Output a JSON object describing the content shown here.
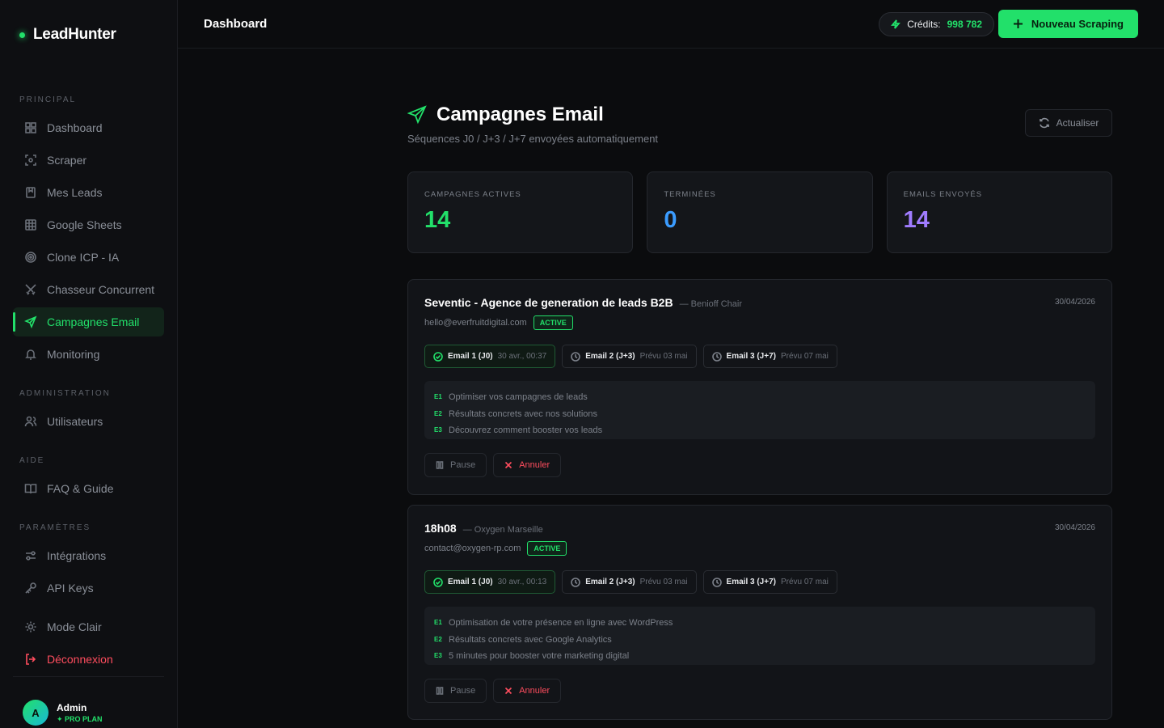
{
  "app": {
    "name": "LeadHunter"
  },
  "sidebar": {
    "sections": [
      "PRINCIPAL",
      "ADMINISTRATION",
      "AIDE",
      "PARAMÈTRES"
    ],
    "items": [
      {
        "label": "Dashboard",
        "icon": "grid-icon"
      },
      {
        "label": "Scraper",
        "icon": "scan-icon"
      },
      {
        "label": "Mes Leads",
        "icon": "bookmark-icon"
      },
      {
        "label": "Google Sheets",
        "icon": "table-icon"
      },
      {
        "label": "Clone ICP - IA",
        "icon": "target-icon"
      },
      {
        "label": "Chasseur Concurrent",
        "icon": "swords-icon"
      },
      {
        "label": "Campagnes Email",
        "icon": "send-icon",
        "active": true
      },
      {
        "label": "Monitoring",
        "icon": "bell-icon"
      },
      {
        "label": "Utilisateurs",
        "icon": "users-icon"
      },
      {
        "label": "FAQ & Guide",
        "icon": "book-icon"
      },
      {
        "label": "Intégrations",
        "icon": "sliders-icon"
      },
      {
        "label": "API Keys",
        "icon": "key-icon"
      },
      {
        "label": "Mode Clair",
        "icon": "sun-icon"
      },
      {
        "label": "Déconnexion",
        "icon": "logout-icon"
      }
    ],
    "user": {
      "initial": "A",
      "name": "Admin",
      "plan": "✦ PRO PLAN"
    }
  },
  "topbar": {
    "title": "Dashboard",
    "credits_label": "Crédits:",
    "credits_value": "998 782",
    "new_button": "Nouveau Scraping"
  },
  "page": {
    "title": "Campagnes Email",
    "subtitle": "Séquences J0 / J+3 / J+7 envoyées automatiquement",
    "refresh": "Actualiser"
  },
  "stats": [
    {
      "label": "CAMPAGNES ACTIVES",
      "value": "14",
      "color": "#22e06a"
    },
    {
      "label": "TERMINÉES",
      "value": "0",
      "color": "#3b9cff"
    },
    {
      "label": "EMAILS ENVOYÉS",
      "value": "14",
      "color": "#a07cff"
    }
  ],
  "campaigns": [
    {
      "name": "Seventic - Agence de generation de leads B2B",
      "contact": "— Benioff Chair",
      "date": "30/04/2026",
      "email": "hello@everfruitdigital.com",
      "status": "ACTIVE",
      "steps": [
        {
          "name": "Email 1 (J0)",
          "meta": "30 avr., 00:37",
          "done": true
        },
        {
          "name": "Email 2 (J+3)",
          "meta": "Prévu 03 mai",
          "done": false
        },
        {
          "name": "Email 3 (J+7)",
          "meta": "Prévu 07 mai",
          "done": false
        }
      ],
      "subjects": [
        {
          "tag": "E1",
          "text": "Optimiser vos campagnes de leads"
        },
        {
          "tag": "E2",
          "text": "Résultats concrets avec nos solutions"
        },
        {
          "tag": "E3",
          "text": "Découvrez comment booster vos leads"
        }
      ],
      "pause": "Pause",
      "cancel": "Annuler"
    },
    {
      "name": "18h08",
      "contact": "— Oxygen Marseille",
      "date": "30/04/2026",
      "email": "contact@oxygen-rp.com",
      "status": "ACTIVE",
      "steps": [
        {
          "name": "Email 1 (J0)",
          "meta": "30 avr., 00:13",
          "done": true
        },
        {
          "name": "Email 2 (J+3)",
          "meta": "Prévu 03 mai",
          "done": false
        },
        {
          "name": "Email 3 (J+7)",
          "meta": "Prévu 07 mai",
          "done": false
        }
      ],
      "subjects": [
        {
          "tag": "E1",
          "text": "Optimisation de votre présence en ligne avec WordPress"
        },
        {
          "tag": "E2",
          "text": "Résultats concrets avec Google Analytics"
        },
        {
          "tag": "E3",
          "text": "5 minutes pour booster votre marketing digital"
        }
      ],
      "pause": "Pause",
      "cancel": "Annuler"
    }
  ]
}
